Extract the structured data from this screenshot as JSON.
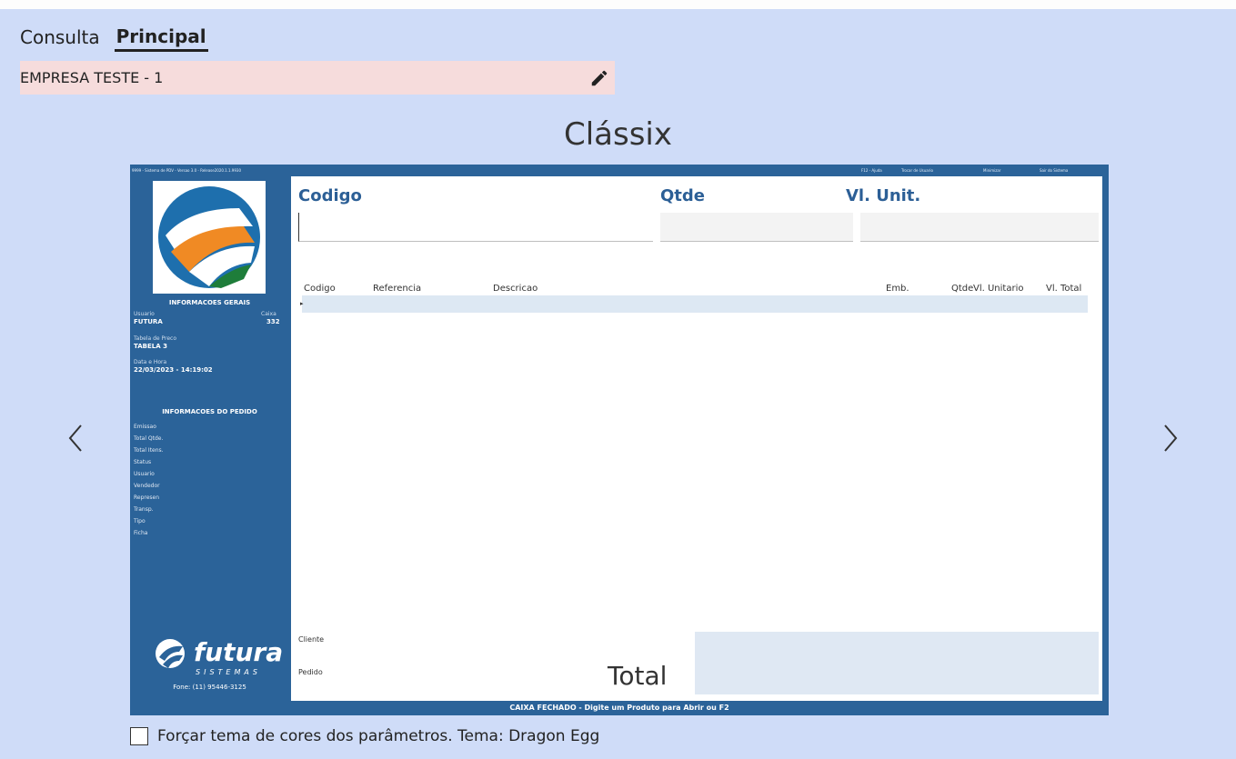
{
  "tabs": [
    {
      "label": "Consulta"
    },
    {
      "label": "Principal"
    }
  ],
  "company": {
    "name": "EMPRESA TESTE - 1",
    "edit_icon": "pencil-icon"
  },
  "theme": {
    "title": "Clássix"
  },
  "nav": {
    "prev_icon": "chevron-left-icon",
    "next_icon": "chevron-right-icon"
  },
  "preview": {
    "title_bar": "9999 - Sistema de PDV - Versao 3.0 - Release2020.1.1.9930",
    "menu": [
      "F12 - Ajuda",
      "Trocar de Usuario",
      "Minimizar",
      "Sair do Sistema"
    ],
    "sidebar": {
      "general_header": "INFORMACOES GERAIS",
      "usuario_label": "Usuario",
      "usuario_value": "FUTURA",
      "caixa_label": "Caixa",
      "caixa_value": "332",
      "tabela_label": "Tabela de Preco",
      "tabela_value": "TABELA 3",
      "data_label": "Data e Hora",
      "data_value": "22/03/2023 - 14:19:02",
      "order_header": "INFORMACOES DO PEDIDO",
      "order_items": [
        "Emissao",
        "Total Qtde.",
        "Total Itens.",
        "Status",
        "Usuario",
        "Vendedor",
        "Represen",
        "Transp.",
        "Tipo",
        "Ficha"
      ],
      "brand_name": "futura",
      "brand_sub": "SISTEMAS",
      "phone": "Fone: (11) 95446-3125"
    },
    "main": {
      "codigo_label": "Codigo",
      "qtde_label": "Qtde",
      "vlunit_label": "Vl. Unit.",
      "columns": [
        "Codigo",
        "Referencia",
        "Descricao",
        "Emb.",
        "Qtde",
        "Vl. Unitario",
        "Vl. Total"
      ],
      "cliente_label": "Cliente",
      "pedido_label": "Pedido",
      "total_label": "Total"
    },
    "status": "CAIXA FECHADO - Digite um Produto para Abrir ou F2",
    "colors": {
      "sidebar": "#2b6399",
      "header_text": "#2c5f96"
    }
  },
  "force_theme": {
    "label": "Forçar tema de cores dos parâmetros. Tema: Dragon Egg",
    "checked": false
  }
}
